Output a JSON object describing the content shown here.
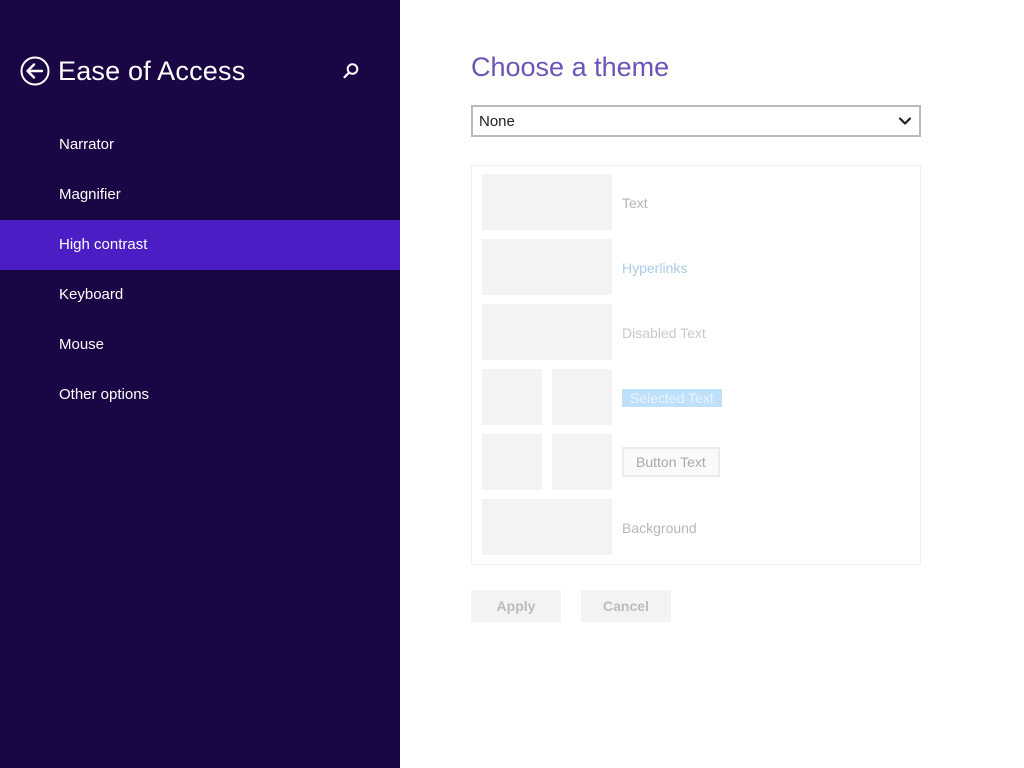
{
  "sidebar": {
    "title": "Ease of Access",
    "back_icon": "back-arrow-circle-icon",
    "search_icon": "search-icon",
    "background_color": "#1a0645",
    "active_color": "#4a1ec4",
    "items": [
      {
        "label": "Narrator",
        "active": false
      },
      {
        "label": "Magnifier",
        "active": false
      },
      {
        "label": "High contrast",
        "active": true
      },
      {
        "label": "Keyboard",
        "active": false
      },
      {
        "label": "Mouse",
        "active": false
      },
      {
        "label": "Other options",
        "active": false
      }
    ]
  },
  "main": {
    "title": "Choose a theme",
    "title_color": "#6b54b6",
    "theme_select": {
      "value": "None",
      "icon": "chevron-down-icon"
    },
    "preview": {
      "text_label": "Text",
      "hyperlinks_label": "Hyperlinks",
      "disabled_label": "Disabled Text",
      "selected_label": "Selected Text",
      "button_label": "Button Text",
      "background_label": "Background"
    },
    "buttons": {
      "apply": "Apply",
      "cancel": "Cancel"
    }
  }
}
